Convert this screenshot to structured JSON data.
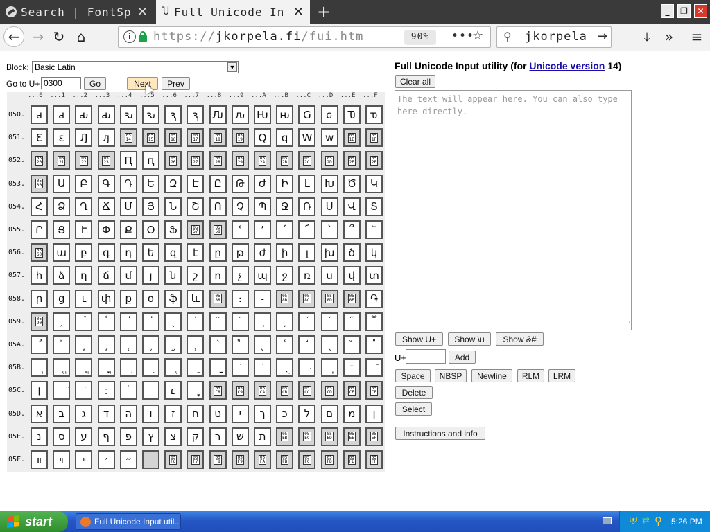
{
  "browser": {
    "tabs": [
      {
        "label": "Search | FontSp",
        "active": false
      },
      {
        "label": "Full Unicode In",
        "active": true
      }
    ],
    "new_tab_label": "+",
    "url_prefix": "https://",
    "url_domain": "jkorpela.fi",
    "url_path": "/fui.htm",
    "zoom": "90%",
    "search_text": "jkorpela"
  },
  "page": {
    "block_label": "Block:",
    "block_value": "Basic Latin",
    "goto_label": "Go to U+",
    "goto_value": "0300",
    "go_button": "Go",
    "next_button": "Next",
    "prev_button": "Prev",
    "heading_prefix": "Full Unicode Input utility (for ",
    "heading_link": "Unicode version",
    "heading_suffix": " 14)",
    "clear_all": "Clear all",
    "textarea_placeholder": "The text will appear here. You can also type here directly.",
    "show_uplus": "Show U+",
    "show_u": "Show \\u",
    "show_amp": "Show &#",
    "uplus_label": "U+",
    "add_button": "Add",
    "space_button": "Space",
    "nbsp_button": "NBSP",
    "newline_button": "Newline",
    "rlm_button": "RLM",
    "lrm_button": "LRM",
    "delete_button": "Delete",
    "select_button": "Select",
    "instructions_button": "Instructions and info"
  },
  "grid": {
    "col_headers": [
      "...0",
      "...1",
      "...2",
      "...3",
      "...4",
      "...5",
      "...6",
      "...7",
      "...8",
      "...9",
      "...A",
      "...B",
      "...C",
      "...D",
      "...E",
      "...F"
    ],
    "rows": [
      {
        "label": "050.",
        "cells": [
          "ԁ",
          "ԁ",
          "ԃ",
          "ԃ",
          "ԅ",
          "ԅ",
          "ԇ",
          "ԇ",
          "Ԉ",
          "ԉ",
          "Ԋ",
          "ԋ",
          "Ԍ",
          "ԍ",
          "Ԏ",
          "ԏ"
        ]
      },
      {
        "label": "051.",
        "cells": [
          "Ԑ",
          "ԑ",
          "Ԓ",
          "ԓ",
          "#0514",
          "#0515",
          "#0516",
          "#0517",
          "#0518",
          "#0519",
          "Ԛ",
          "ԛ",
          "Ԝ",
          "ԝ",
          "#051E",
          "#051F"
        ]
      },
      {
        "label": "052.",
        "cells": [
          "#0520",
          "#0521",
          "#0522",
          "#0523",
          "Ԥ",
          "ԥ",
          "#0526",
          "#0527",
          "#0528",
          "#0529",
          "#052A",
          "#052B",
          "#052C",
          "#052D",
          "#052E",
          "#052F"
        ]
      },
      {
        "label": "053.",
        "cells": [
          "#0530",
          "Ա",
          "Բ",
          "Գ",
          "Դ",
          "Ե",
          "Զ",
          "Է",
          "Ը",
          "Թ",
          "Ժ",
          "Ի",
          "Լ",
          "Խ",
          "Ծ",
          "Կ"
        ]
      },
      {
        "label": "054.",
        "cells": [
          "Հ",
          "Ձ",
          "Ղ",
          "Ճ",
          "Մ",
          "Յ",
          "Ն",
          "Շ",
          "Ո",
          "Չ",
          "Պ",
          "Ջ",
          "Ռ",
          "Ս",
          "Վ",
          "Տ"
        ]
      },
      {
        "label": "055.",
        "cells": [
          "Ր",
          "Ց",
          "Ւ",
          "Փ",
          "Ք",
          "Օ",
          "Ֆ",
          "#0557",
          "#0558",
          "ՙ",
          "՚",
          "՛",
          "՜",
          "՝",
          "՞",
          "՟"
        ]
      },
      {
        "label": "056.",
        "cells": [
          "#0560",
          "ա",
          "բ",
          "գ",
          "դ",
          "ե",
          "զ",
          "է",
          "ը",
          "թ",
          "ժ",
          "ի",
          "լ",
          "խ",
          "ծ",
          "կ"
        ]
      },
      {
        "label": "057.",
        "cells": [
          "հ",
          "ձ",
          "ղ",
          "ճ",
          "մ",
          "յ",
          "ն",
          "շ",
          "ո",
          "չ",
          "պ",
          "ջ",
          "ռ",
          "ս",
          "վ",
          "տ"
        ]
      },
      {
        "label": "058.",
        "cells": [
          "ր",
          "ց",
          "ւ",
          "փ",
          "ք",
          "օ",
          "ֆ",
          "և",
          "#0588",
          "։",
          "֊",
          "#058B",
          "#058C",
          "#058D",
          "#058E",
          "֏"
        ]
      },
      {
        "label": "059.",
        "cells": [
          "#0590",
          "֑",
          "֒",
          "֓",
          "֔",
          "֕",
          "֖",
          "֗",
          "֘",
          "֙",
          "֚",
          "֛",
          "֜",
          "֝",
          "֞",
          "֟"
        ]
      },
      {
        "label": "05A.",
        "cells": [
          "֠",
          "֡",
          "֢",
          "֣",
          "֤",
          "֥",
          "֦",
          "֧",
          "֨",
          "֩",
          "֪",
          "֫",
          "֬",
          "֭",
          "֮",
          "֯"
        ]
      },
      {
        "label": "05B.",
        "cells": [
          "ְ",
          "ֱ",
          "ֲ",
          "ֳ",
          "ִ",
          "ֵ",
          "ֶ",
          "ַ",
          "ָ",
          "ֹ",
          "ֺ",
          "ֻ",
          "ּ",
          "ֽ",
          "־",
          "ֿ"
        ]
      },
      {
        "label": "05C.",
        "cells": [
          "׀",
          "ׁ",
          "ׂ",
          "׃",
          "ׄ",
          "ׅ",
          "׆",
          "ׇ",
          "#05C8",
          "#05C9",
          "#05CA",
          "#05CB",
          "#05CC",
          "#05CD",
          "#05CE",
          "#05CF"
        ]
      },
      {
        "label": "05D.",
        "cells": [
          "א",
          "ב",
          "ג",
          "ד",
          "ה",
          "ו",
          "ז",
          "ח",
          "ט",
          "י",
          "ך",
          "כ",
          "ל",
          "ם",
          "מ",
          "ן"
        ]
      },
      {
        "label": "05E.",
        "cells": [
          "נ",
          "ס",
          "ע",
          "ף",
          "פ",
          "ץ",
          "צ",
          "ק",
          "ר",
          "ש",
          "ת",
          "#05EB",
          "#05EC",
          "#05ED",
          "#05EE",
          "#05EF"
        ]
      },
      {
        "label": "05F.",
        "cells": [
          "װ",
          "ױ",
          "ײ",
          "׳",
          "״",
          "",
          "#05F6",
          "#05F7",
          "#05F8",
          "#05F9",
          "#05FA",
          "#05FB",
          "#05FC",
          "#05FD",
          "#05FE",
          "#05FF"
        ]
      }
    ]
  },
  "taskbar": {
    "start_label": "start",
    "task_label": "Full Unicode Input util...",
    "clock": "5:26 PM"
  },
  "colors": {
    "tabbar": "#3a3a3a",
    "link": "#1a0dab",
    "taskbar": "#245edb",
    "start": "#3c9e3a",
    "close": "#d8392b"
  }
}
